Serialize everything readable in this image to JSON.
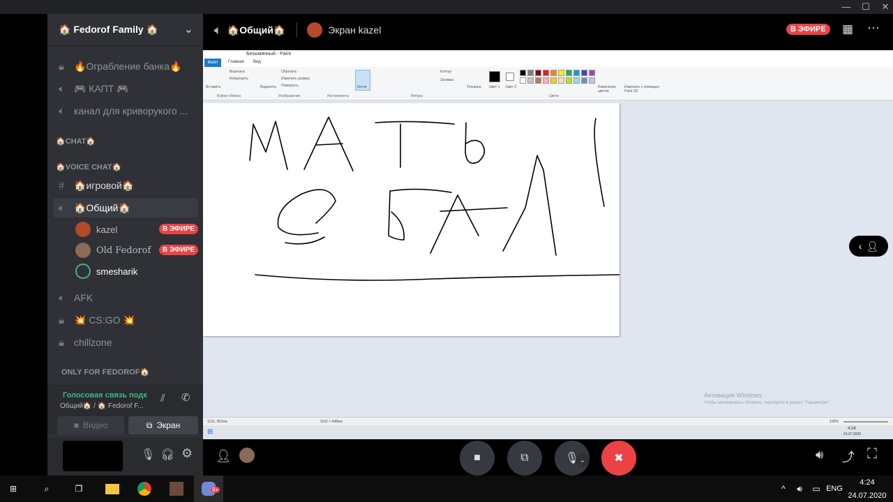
{
  "window": {
    "minimize": "—",
    "maximize": "☐",
    "close": "✕"
  },
  "server": {
    "name": "🏠 Fedorof Family 🏠"
  },
  "channels": {
    "text_top": [
      {
        "label": "🔥Ограбление банка🔥",
        "icon": "lock-icon"
      },
      {
        "label": "🎮 КАПТ 🎮",
        "icon": "speaker-icon"
      },
      {
        "label": "канал для криворукого ...",
        "icon": "speaker-icon"
      }
    ],
    "category_chat": "🏠CHAT🏠",
    "category_voice": "🏠VOICE CHAT🏠",
    "voice_list": [
      {
        "label": "🏠игровой🏠",
        "icon": "hash-icon"
      },
      {
        "label": "🏠Общий🏠",
        "icon": "speaker-icon"
      }
    ],
    "voice_users": [
      {
        "name": "kazel",
        "live": "В ЭФИРЕ"
      },
      {
        "name": "Old Fedorof",
        "live": "В ЭФИРЕ"
      },
      {
        "name": "smesharik",
        "live": ""
      }
    ],
    "more": [
      {
        "label": "AFK",
        "icon": "speaker-icon"
      },
      {
        "label": "💥 CS:GO 💥",
        "icon": "lock-icon"
      },
      {
        "label": "chillzone",
        "icon": "lock-icon"
      }
    ],
    "category_only": "ONLY FOR FEDOROF🏠"
  },
  "voice_panel": {
    "status": "Голосовая связь подк",
    "subtitle": "Общий🏠 / 🏠 Fedorof F...",
    "video_label": "Видео",
    "screen_label": "Экран"
  },
  "stream": {
    "channel": "🏠Общий🏠",
    "screen_title": "Экран kazel",
    "live_badge": "В ЭФИРЕ"
  },
  "paint": {
    "title": "Безымянный - Paint",
    "tab_file": "Файл",
    "tab_home": "Главная",
    "tab_view": "Вид",
    "groups": [
      "Буфер обмена",
      "Изображение",
      "Инструменты",
      "Фигуры",
      "Цвета"
    ],
    "tools": {
      "paste": "Вставить",
      "cut": "Вырезать",
      "copy": "Копировать",
      "select": "Выделить",
      "crop": "Обрезать",
      "resize": "Изменить размер",
      "rotate": "Повернуть",
      "brushes": "Кисти",
      "outline": "Контур",
      "fill": "Заливка",
      "size": "Толщина",
      "color1": "Цвет 1",
      "color2": "Цвет 2",
      "edit_colors": "Изменение цветов",
      "paint3d": "Изменить с помощью Paint 3D"
    },
    "activation_title": "Активация Windows",
    "activation_sub": "Чтобы активировать Windows, перейдите в раздел \"Параметры\".",
    "status_pos": "1131, 352пкс",
    "status_size": "1152 × 648пкс",
    "zoom": "100%",
    "inner_time": "4:24",
    "inner_date": "24.07.2020"
  },
  "taskbar": {
    "lang": "ENG",
    "time": "4:24",
    "date": "24.07.2020",
    "badge": "9+"
  },
  "palette": [
    "#000000",
    "#7f7f7f",
    "#880015",
    "#ed1c24",
    "#ff7f27",
    "#fff200",
    "#22b14c",
    "#00a2e8",
    "#3f48cc",
    "#a349a4",
    "#ffffff",
    "#c3c3c3",
    "#b97a57",
    "#ffaec9",
    "#ffc90e",
    "#efe4b0",
    "#b5e61d",
    "#99d9ea",
    "#7092be",
    "#c8bfe7"
  ]
}
